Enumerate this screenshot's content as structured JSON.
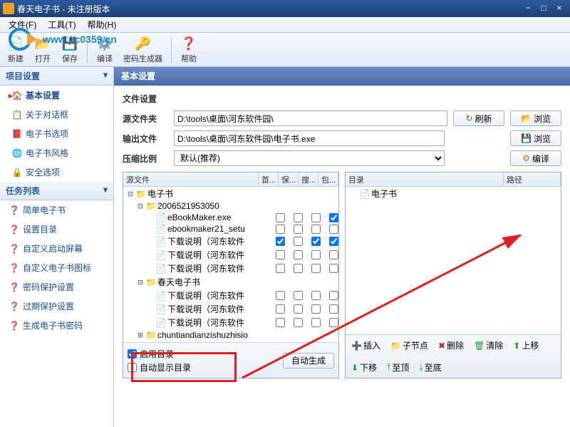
{
  "window": {
    "title": "春天电子书 - 未注册版本"
  },
  "menu": {
    "file": "文件(F)",
    "tools": "工具(T)",
    "help": "帮助(H)"
  },
  "toolbar": {
    "new": "新建",
    "open": "打开",
    "save": "保存",
    "compile": "编译",
    "pwdgen": "密码生成器",
    "help": "帮助"
  },
  "sidebar": {
    "section1": "项目设置",
    "items1": [
      {
        "label": "基本设置",
        "icon": "🏠",
        "active": true
      },
      {
        "label": "关于对话框",
        "icon": "📋"
      },
      {
        "label": "电子书选项",
        "icon": "📕"
      },
      {
        "label": "电子书风格",
        "icon": "🌐"
      },
      {
        "label": "安全选项",
        "icon": "🔒"
      }
    ],
    "section2": "任务列表",
    "items2": [
      {
        "label": "简单电子书"
      },
      {
        "label": "设置目录"
      },
      {
        "label": "自定义启动屏幕"
      },
      {
        "label": "自定义电子书图标"
      },
      {
        "label": "密码保护设置"
      },
      {
        "label": "过期保护设置"
      },
      {
        "label": "生成电子书密码"
      }
    ]
  },
  "content": {
    "title": "基本设置",
    "file_settings": "文件设置",
    "src_label": "源文件夹",
    "src_value": "D:\\tools\\桌面\\河东软件园\\",
    "out_label": "输出文件",
    "out_value": "D:\\tools\\桌面\\河东软件园\\电子书.exe",
    "comp_label": "压缩比例",
    "comp_value": "默认(推荐)",
    "btn_refresh": "刷新",
    "btn_browse": "浏览",
    "btn_compile": "编译"
  },
  "left_panel": {
    "cols": [
      "源文件",
      "首...",
      "保...",
      "搜...",
      "包..."
    ],
    "tree": [
      {
        "label": "电子书",
        "level": 0,
        "expanded": true,
        "type": "folder"
      },
      {
        "label": "2006521953050",
        "level": 1,
        "expanded": true,
        "type": "folder"
      },
      {
        "label": "eBookMaker.exe",
        "level": 2,
        "type": "file",
        "checks": [
          false,
          false,
          false,
          true
        ]
      },
      {
        "label": "ebookmaker21_setu",
        "level": 2,
        "type": "file",
        "checks": [
          false,
          false,
          false,
          false
        ]
      },
      {
        "label": "下载说明（河东软件",
        "level": 2,
        "type": "file",
        "checks": [
          true,
          false,
          true,
          true
        ]
      },
      {
        "label": "下载说明（河东软件",
        "level": 2,
        "type": "file",
        "checks": [
          false,
          false,
          false,
          false
        ]
      },
      {
        "label": "下载说明（河东软件",
        "level": 2,
        "type": "file",
        "checks": [
          false,
          false,
          false,
          false
        ]
      },
      {
        "label": "春天电子书",
        "level": 1,
        "expanded": true,
        "type": "folder"
      },
      {
        "label": "下载说明（河东软件",
        "level": 2,
        "type": "file",
        "checks": [
          false,
          false,
          false,
          false
        ]
      },
      {
        "label": "下载说明（河东软件",
        "level": 2,
        "type": "file",
        "checks": [
          false,
          false,
          false,
          false
        ]
      },
      {
        "label": "下载说明（河东软件",
        "level": 2,
        "type": "file",
        "checks": [
          false,
          false,
          false,
          false
        ]
      },
      {
        "label": "chuntiandianzishuzhisio",
        "level": 1,
        "expanded": false,
        "type": "folder"
      }
    ],
    "enable_dir": "启用目录",
    "auto_show": "自动显示目录",
    "auto_gen": "自动生成"
  },
  "right_panel": {
    "cols": [
      "目录",
      "路径"
    ],
    "tree": [
      {
        "label": "电子书",
        "icon": "📄"
      }
    ],
    "footer": {
      "insert": "插入",
      "child": "子节点",
      "delete": "删除",
      "clear": "清除",
      "up": "上移",
      "down": "下移",
      "top": "至顶",
      "bottom": "至底"
    }
  },
  "watermark": {
    "url": "www.pc0359.cn"
  }
}
